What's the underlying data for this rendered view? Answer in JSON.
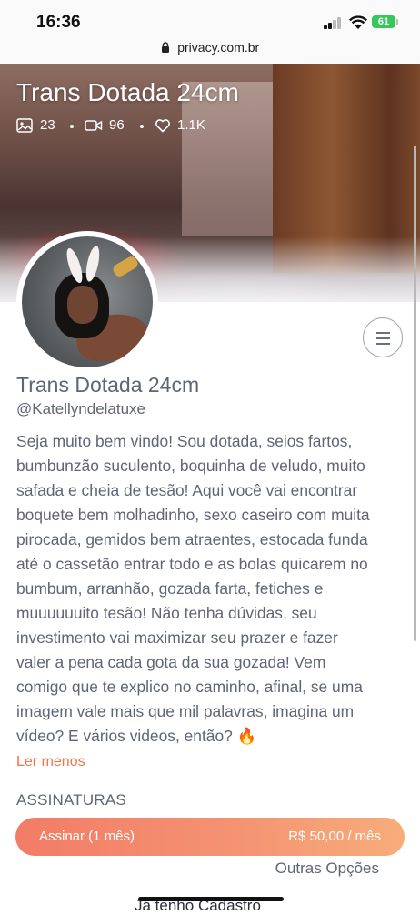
{
  "status_bar": {
    "time": "16:36",
    "battery": "61"
  },
  "browser": {
    "url": "privacy.com.br"
  },
  "cover": {
    "title": "Trans Dotada 24cm",
    "stats": {
      "photos": "23",
      "videos": "96",
      "likes": "1.1K"
    }
  },
  "profile": {
    "name": "Trans Dotada 24cm",
    "handle": "@Katellyndelatuxe",
    "bio_lines": [
      "Seja muito bem vindo! Sou dotada, seios fartos,",
      "bumbunzão suculento, boquinha de veludo, muito",
      "safada e cheia de tesão! Aqui você vai encontrar",
      "boquete bem molhadinho, sexo caseiro com muita",
      "pirocada, gemidos bem atraentes, estocada funda",
      "até o cassetão entrar todo e as bolas quicarem no",
      "bumbum, arranhão, gozada farta, fetiches e",
      "muuuuuuito tesão! Não tenha dúvidas, seu",
      "investimento vai maximizar seu prazer e fazer",
      "valer a pena cada gota da sua gozada! Vem",
      "comigo que te explico no caminho, afinal, se uma",
      "imagem vale mais que mil palavras, imagina um",
      "vídeo? E vários videos, então? 🔥"
    ],
    "read_less": "Ler menos"
  },
  "subscriptions": {
    "title": "ASSINATURAS",
    "plan_label": "Assinar (1 mês)",
    "plan_price": "R$ 50,00 / mês",
    "other_options": "Outras Opções",
    "already_registered": "Já tenho Cadastro"
  },
  "icons": {
    "photos": "image-icon",
    "videos": "video-camera-icon",
    "likes": "heart-icon",
    "menu": "hamburger-menu-icon",
    "lock": "lock-icon"
  },
  "colors": {
    "accent": "#f2734b",
    "button_gradient_start": "#f27c66",
    "button_gradient_end": "#f7ad7a",
    "text": "#5f6577"
  }
}
